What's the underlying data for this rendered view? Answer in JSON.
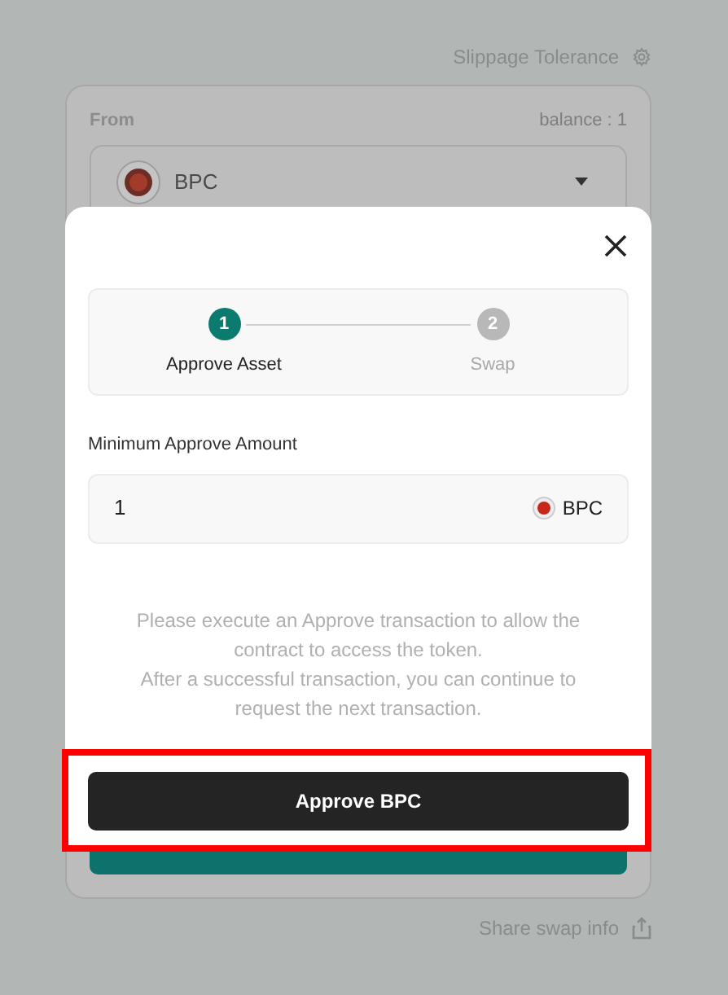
{
  "header": {
    "settings_label": "Slippage Tolerance"
  },
  "swap_card": {
    "from_label": "From",
    "balance": "balance : 1",
    "token": "BPC"
  },
  "modal": {
    "steps": [
      {
        "number": "1",
        "label": "Approve Asset",
        "selected": true
      },
      {
        "number": "2",
        "label": "Swap",
        "selected": false
      }
    ],
    "amount_label": "Minimum Approve Amount",
    "amount_value": "1",
    "amount_token": "BPC",
    "description": [
      "Please execute an Approve transaction to allow the contract to access the token.",
      "After a successful transaction, you can continue to request the next transaction."
    ],
    "approve_button": "Approve BPC"
  },
  "footer": {
    "share_label": "Share swap info"
  }
}
